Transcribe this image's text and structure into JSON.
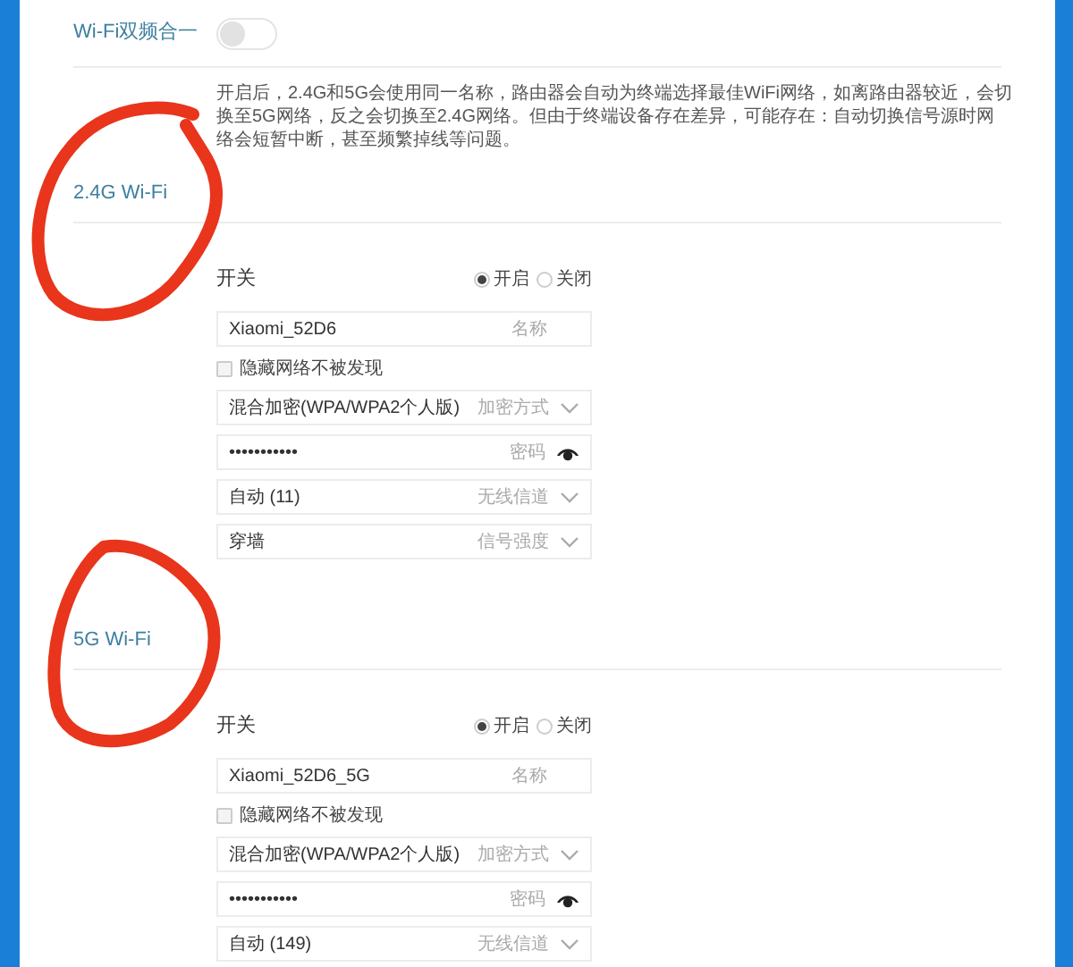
{
  "dual_band": {
    "label": "Wi-Fi双频合一",
    "on": false,
    "description": "开启后，2.4G和5G会使用同一名称，路由器会自动为终端选择最佳WiFi网络，如离路由器较近，会切换至5G网络，反之会切换至2.4G网络。但由于终端设备存在差异，可能存在：自动切换信号源时网络会短暂中断，甚至频繁掉线等问题。"
  },
  "bands": [
    {
      "title": "2.4G Wi-Fi",
      "switch_label": "开关",
      "options": [
        {
          "label": "开启",
          "selected": true
        },
        {
          "label": "关闭",
          "selected": false
        }
      ],
      "fields": [
        {
          "kind": "text",
          "value": "Xiaomi_52D6",
          "tag": "名称"
        },
        {
          "kind": "checkbox",
          "label": "隐藏网络不被发现",
          "checked": false
        },
        {
          "kind": "select",
          "value": "混合加密(WPA/WPA2个人版)",
          "tag": "加密方式"
        },
        {
          "kind": "password",
          "value": "•••••••••••",
          "tag": "密码"
        },
        {
          "kind": "select",
          "value": "自动 (11)",
          "tag": "无线信道"
        },
        {
          "kind": "select",
          "value": "穿墙",
          "tag": "信号强度"
        }
      ]
    },
    {
      "title": "5G Wi-Fi",
      "switch_label": "开关",
      "options": [
        {
          "label": "开启",
          "selected": true
        },
        {
          "label": "关闭",
          "selected": false
        }
      ],
      "fields": [
        {
          "kind": "text",
          "value": "Xiaomi_52D6_5G",
          "tag": "名称"
        },
        {
          "kind": "checkbox",
          "label": "隐藏网络不被发现",
          "checked": false
        },
        {
          "kind": "select",
          "value": "混合加密(WPA/WPA2个人版)",
          "tag": "加密方式"
        },
        {
          "kind": "password",
          "value": "•••••••••••",
          "tag": "密码"
        },
        {
          "kind": "select",
          "value": "自动 (149)",
          "tag": "无线信道"
        }
      ]
    }
  ]
}
